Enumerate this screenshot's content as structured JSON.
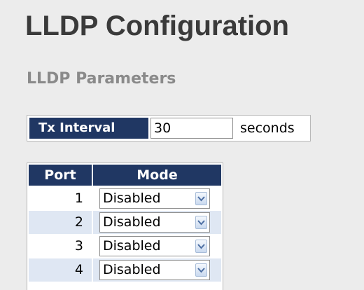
{
  "page": {
    "title": "LLDP Configuration",
    "section_title": "LLDP Parameters"
  },
  "tx_interval": {
    "label": "Tx Interval",
    "value": "30",
    "unit": "seconds"
  },
  "port_table": {
    "headers": {
      "port": "Port",
      "mode": "Mode"
    },
    "rows": [
      {
        "port": "1",
        "mode": "Disabled"
      },
      {
        "port": "2",
        "mode": "Disabled"
      },
      {
        "port": "3",
        "mode": "Disabled"
      },
      {
        "port": "4",
        "mode": "Disabled"
      }
    ]
  },
  "colors": {
    "header_bg": "#203763",
    "alt_row_bg": "#dfe7f3",
    "page_bg": "#ececec"
  },
  "icons": {
    "dropdown": "chevron-down-icon"
  }
}
